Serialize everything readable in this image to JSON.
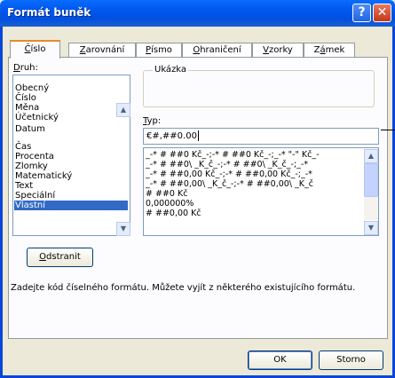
{
  "window": {
    "title": "Formát buněk",
    "help_icon": "?",
    "close_icon": "✕"
  },
  "tabs": [
    {
      "label_pre": "",
      "accel": "Č",
      "label_post": "íslo",
      "active": true
    },
    {
      "label_pre": "",
      "accel": "Z",
      "label_post": "arovnání",
      "active": false
    },
    {
      "label_pre": "",
      "accel": "P",
      "label_post": "ísmo",
      "active": false
    },
    {
      "label_pre": "",
      "accel": "O",
      "label_post": "hraničení",
      "active": false
    },
    {
      "label_pre": "",
      "accel": "V",
      "label_post": "zorky",
      "active": false
    },
    {
      "label_pre": "Z",
      "accel": "á",
      "label_post": "mek",
      "active": false
    }
  ],
  "category": {
    "label_accel": "D",
    "label_rest": "ruh:",
    "items": [
      "Obecný",
      "Číslo",
      "Měna",
      "Účetnický",
      "Datum",
      "Čas",
      "Procenta",
      "Zlomky",
      "Matematický",
      "Text",
      "Speciální",
      "Vlastní"
    ],
    "selected": "Vlastní"
  },
  "sample": {
    "label": "Ukázka"
  },
  "type": {
    "label_accel": "T",
    "label_rest": "yp:",
    "value": "€#,##0.00"
  },
  "formats": [
    "_-* # ##0 Kč_-;-* # ##0 Kč_-;_-* \"-\" Kč_-",
    "_-* # ##0\\ _K_č_-;-* # ##0\\ _K_č_-;_-*",
    "_-* # ##0,00 Kč_-;-* # ##0,00 Kč_-;_-*",
    "_-* # ##0,00\\ _K_č_-;-* # ##0,00\\ _K_č",
    "# ##0 Kč",
    "0,000000%",
    "# ##0,00 Kč"
  ],
  "delete_button": {
    "accel": "O",
    "rest": "dstranit"
  },
  "description": "Zadejte kód číselného formátu. Můžete vyjít z některého existujícího formátu.",
  "ok_label": "OK",
  "cancel_label": "Storno"
}
